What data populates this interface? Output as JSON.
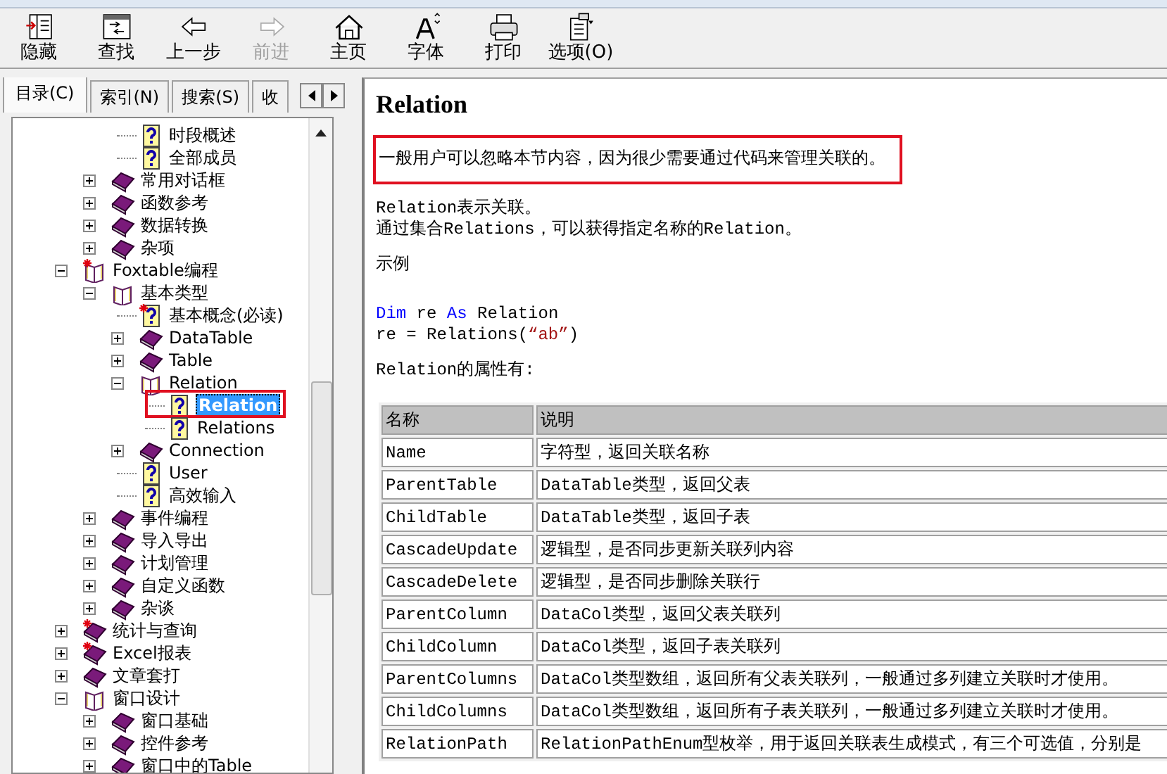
{
  "toolbar": [
    {
      "label": "隐藏",
      "disabled": false
    },
    {
      "label": "查找",
      "disabled": false
    },
    {
      "label": "上一步",
      "disabled": false
    },
    {
      "label": "前进",
      "disabled": true
    },
    {
      "label": "主页",
      "disabled": false
    },
    {
      "label": "字体",
      "disabled": false
    },
    {
      "label": "打印",
      "disabled": false
    },
    {
      "label": "选项(O)",
      "disabled": false
    }
  ],
  "tabs": [
    {
      "label": "目录(C)",
      "selected": true
    },
    {
      "label": "索引(N)",
      "selected": false
    },
    {
      "label": "搜索(S)",
      "selected": false
    },
    {
      "label": "收",
      "selected": false
    }
  ],
  "tree": [
    {
      "children": [
        {
          "children": [
            {
              "kind": "page",
              "label": "时段概述"
            },
            {
              "kind": "page",
              "label": "全部成员"
            }
          ]
        },
        {
          "kind": "book",
          "label": "常用对话框",
          "expanded": false
        },
        {
          "kind": "book",
          "label": "函数参考",
          "expanded": false
        },
        {
          "kind": "book",
          "label": "数据转换",
          "expanded": false
        },
        {
          "kind": "book",
          "label": "杂项",
          "expanded": false
        }
      ]
    },
    {
      "kind": "book",
      "label": "Foxtable编程",
      "expanded": true,
      "new": true,
      "children": [
        {
          "kind": "book",
          "label": "基本类型",
          "expanded": true,
          "children": [
            {
              "kind": "page",
              "label": "基本概念(必读)",
              "new": true
            },
            {
              "kind": "book",
              "label": "DataTable",
              "expanded": false
            },
            {
              "kind": "book",
              "label": "Table",
              "expanded": false
            },
            {
              "kind": "book",
              "label": "Relation",
              "expanded": true,
              "children": [
                {
                  "kind": "page",
                  "label": "Relation",
                  "selected": true,
                  "boxed": true
                },
                {
                  "kind": "page",
                  "label": "Relations",
                  "selected": false
                }
              ]
            },
            {
              "kind": "book",
              "label": "Connection",
              "expanded": false
            },
            {
              "kind": "page",
              "label": "User"
            },
            {
              "kind": "page",
              "label": "高效输入"
            }
          ]
        },
        {
          "kind": "book",
          "label": "事件编程",
          "expanded": false
        },
        {
          "kind": "book",
          "label": "导入导出",
          "expanded": false
        },
        {
          "kind": "book",
          "label": "计划管理",
          "expanded": false
        },
        {
          "kind": "book",
          "label": "自定义函数",
          "expanded": false
        },
        {
          "kind": "book",
          "label": "杂谈",
          "expanded": false
        }
      ]
    },
    {
      "kind": "book",
      "label": "统计与查询",
      "expanded": false,
      "new": true
    },
    {
      "kind": "book",
      "label": "Excel报表",
      "expanded": false,
      "new": true
    },
    {
      "kind": "book",
      "label": "文章套打",
      "expanded": false
    },
    {
      "kind": "book",
      "label": "窗口设计",
      "expanded": true,
      "children": [
        {
          "kind": "book",
          "label": "窗口基础",
          "expanded": false
        },
        {
          "kind": "book",
          "label": "控件参考",
          "expanded": false
        },
        {
          "kind": "book",
          "label": "窗口中的Table",
          "expanded": false
        }
      ]
    }
  ],
  "topic": {
    "title": "Relation",
    "note": {
      "text": "一般用户可以忽略本节内容，因为很少需要通过代码来管理关联的。",
      "boxed": true
    },
    "intro": [
      "Relation表示关联。",
      "通过集合Relations，可以获得指定名称的Relation。"
    ],
    "example_heading": "示例",
    "code": [
      [
        {
          "kind": "keyword",
          "text": "Dim"
        },
        {
          "kind": "plain",
          "text": " re "
        },
        {
          "kind": "keyword",
          "text": "As"
        },
        {
          "kind": "plain",
          "text": " Relation"
        }
      ],
      [
        {
          "kind": "plain",
          "text": "re = Relations("
        },
        {
          "kind": "string",
          "text": "“ab”"
        },
        {
          "kind": "plain",
          "text": ")"
        }
      ]
    ],
    "properties_heading": "Relation的属性有:",
    "table": {
      "columns": [
        "名称",
        "说明"
      ],
      "rows": [
        [
          "Name",
          "字符型，返回关联名称"
        ],
        [
          "ParentTable",
          "DataTable类型，返回父表"
        ],
        [
          "ChildTable",
          "DataTable类型，返回子表"
        ],
        [
          "CascadeUpdate",
          "逻辑型，是否同步更新关联列内容"
        ],
        [
          "CascadeDelete",
          "逻辑型，是否同步删除关联行"
        ],
        [
          "ParentColumn",
          "DataCol类型，返回父表关联列"
        ],
        [
          "ChildColumn",
          "DataCol类型，返回子表关联列"
        ],
        [
          "ParentColumns",
          "DataCol类型数组，返回所有父表关联列，一般通过多列建立关联时才使用。"
        ],
        [
          "ChildColumns",
          "DataCol类型数组，返回所有子表关联列，一般通过多列建立关联时才使用。"
        ],
        [
          "RelationPath",
          "RelationPathEnum型枚举，用于返回关联表生成模式，有三个可选值，分别是"
        ]
      ]
    }
  }
}
